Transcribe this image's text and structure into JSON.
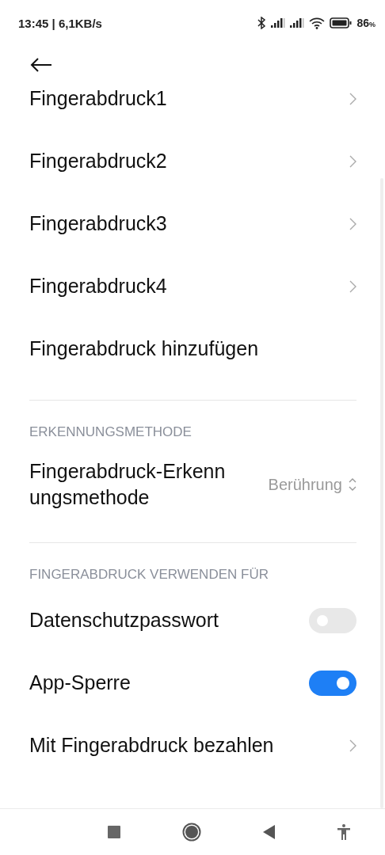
{
  "status_bar": {
    "time": "13:45",
    "separator": "|",
    "speed": "6,1KB/s",
    "battery": "86",
    "battery_unit": "%"
  },
  "items": [
    {
      "kind": "link",
      "label": "Fingerabdruck1"
    },
    {
      "kind": "link",
      "label": "Fingerabdruck2"
    },
    {
      "kind": "link",
      "label": "Fingerabdruck3"
    },
    {
      "kind": "link",
      "label": "Fingerabdruck4"
    },
    {
      "kind": "action",
      "label": "Fingerabdruck hinzufügen"
    },
    {
      "kind": "divider"
    },
    {
      "kind": "header",
      "label": "ERKENNUNGSMETHODE"
    },
    {
      "kind": "select",
      "label": "Fingerabdruck-Erkenn ungsmethode",
      "value": "Berührung"
    },
    {
      "kind": "divider"
    },
    {
      "kind": "header",
      "label": "FINGERABDRUCK VERWENDEN FÜR"
    },
    {
      "kind": "toggle",
      "label": "Datenschutzpasswort",
      "on": false
    },
    {
      "kind": "toggle",
      "label": "App-Sperre",
      "on": true
    },
    {
      "kind": "link",
      "label": "Mit Fingerabdruck bezahlen"
    }
  ]
}
